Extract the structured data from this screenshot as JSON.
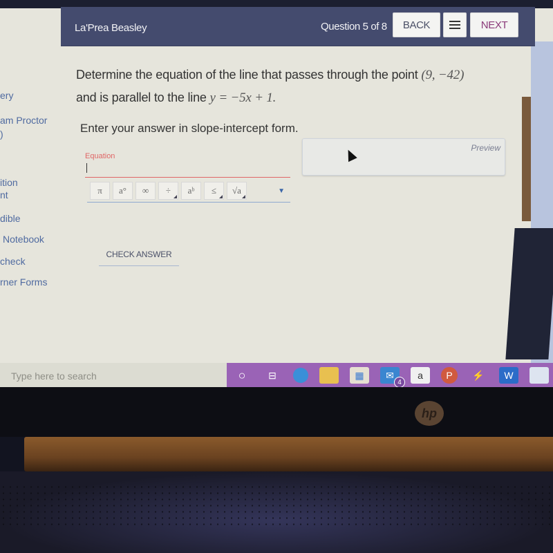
{
  "header": {
    "student_name": "La'Prea Beasley",
    "question_counter": "Question 5 of 8",
    "back_label": "BACK",
    "next_label": "NEXT"
  },
  "sidebar": {
    "items": [
      {
        "label": "ery"
      },
      {
        "label": "am Proctor"
      },
      {
        "label": ")"
      },
      {
        "label": "ition"
      },
      {
        "label": "nt"
      },
      {
        "label": "dible"
      },
      {
        "label": "Notebook"
      },
      {
        "label": "check"
      },
      {
        "label": "rner Forms"
      }
    ]
  },
  "question": {
    "text_1": "Determine the equation of the line that passes through the point ",
    "point": "(9, −42)",
    "text_2": "and is parallel to the line ",
    "line_eq": "y = −5x + 1",
    "text_3": ".",
    "instruction": "Enter your answer in slope-intercept form."
  },
  "answer": {
    "label": "Equation",
    "value": "",
    "preview_label": "Preview",
    "check_label": "CHECK ANSWER"
  },
  "math_toolbar": {
    "buttons": [
      {
        "symbol": "π",
        "name": "pi"
      },
      {
        "symbol": "a°",
        "name": "degree"
      },
      {
        "symbol": "∞",
        "name": "infinity"
      },
      {
        "symbol": "÷",
        "name": "divide"
      },
      {
        "symbol": "aᵇ",
        "name": "exponent"
      },
      {
        "symbol": "≤",
        "name": "less-equal"
      },
      {
        "symbol": "√a",
        "name": "sqrt"
      }
    ]
  },
  "taskbar": {
    "search_placeholder": "Type here to search",
    "mail_badge": "4",
    "apps": [
      "cortana",
      "task-view",
      "edge",
      "file-explorer",
      "store",
      "mail",
      "amazon",
      "powerpoint",
      "app",
      "word",
      "app"
    ]
  },
  "device": {
    "brand": "hp"
  }
}
